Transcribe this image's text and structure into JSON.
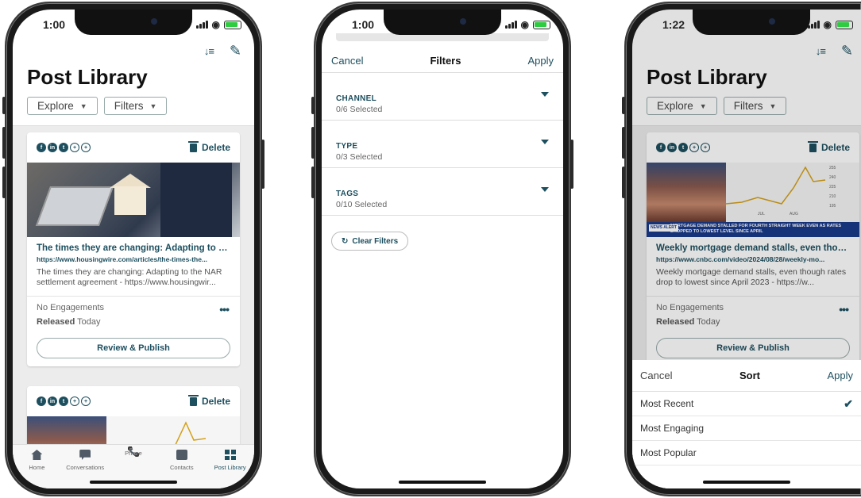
{
  "phone1": {
    "time": "1:00",
    "title": "Post Library",
    "chips": [
      {
        "label": "Explore"
      },
      {
        "label": "Filters"
      }
    ],
    "cards": [
      {
        "delete_label": "Delete",
        "title": "The times they are changing: Adapting to the...",
        "url": "https://www.housingwire.com/articles/the-times-the...",
        "desc": "The times they are changing: Adapting to the NAR settlement agreement - https://www.housingwir...",
        "engagements": "No Engagements",
        "released_label": "Released",
        "released_value": "Today",
        "action": "Review & Publish"
      },
      {
        "delete_label": "Delete"
      }
    ],
    "tabs": [
      {
        "label": "Home",
        "icon": "home-icon"
      },
      {
        "label": "Conversations",
        "icon": "chat-icon"
      },
      {
        "label": "Phone",
        "icon": "phone-icon"
      },
      {
        "label": "Contacts",
        "icon": "contacts-icon"
      },
      {
        "label": "Post Library",
        "icon": "grid-icon"
      }
    ]
  },
  "phone2": {
    "time": "1:00",
    "cancel": "Cancel",
    "title": "Filters",
    "apply": "Apply",
    "sections": [
      {
        "label": "CHANNEL",
        "sub": "0/6 Selected"
      },
      {
        "label": "TYPE",
        "sub": "0/3 Selected"
      },
      {
        "label": "TAGS",
        "sub": "0/10 Selected"
      }
    ],
    "clear": "Clear Filters"
  },
  "phone3": {
    "time": "1:22",
    "title": "Post Library",
    "chips": [
      {
        "label": "Explore"
      },
      {
        "label": "Filters"
      }
    ],
    "card": {
      "delete_label": "Delete",
      "ticker_tag": "NEWS ALERT",
      "ticker": "MORTGAGE DEMAND STALLED FOR FOURTH STRAIGHT WEEK EVEN AS RATES DROPPED TO LOWEST LEVEL SINCE APRIL",
      "chart_ticks": [
        "255",
        "240",
        "225",
        "210",
        "195"
      ],
      "chart_months": [
        "JUL",
        "AUG"
      ],
      "title": "Weekly mortgage demand stalls, even thoug...",
      "url": "https://www.cnbc.com/video/2024/08/28/weekly-mo...",
      "desc": "Weekly mortgage demand stalls, even though rates drop to lowest since April 2023 - https://w...",
      "engagements": "No Engagements",
      "released_label": "Released",
      "released_value": "Today",
      "action": "Review & Publish"
    },
    "sort": {
      "cancel": "Cancel",
      "title": "Sort",
      "apply": "Apply",
      "options": [
        "Most Recent",
        "Most Engaging",
        "Most Popular"
      ],
      "selected": "Most Recent"
    }
  },
  "colors": {
    "accent": "#1d4f5f",
    "background": "#ececec"
  }
}
